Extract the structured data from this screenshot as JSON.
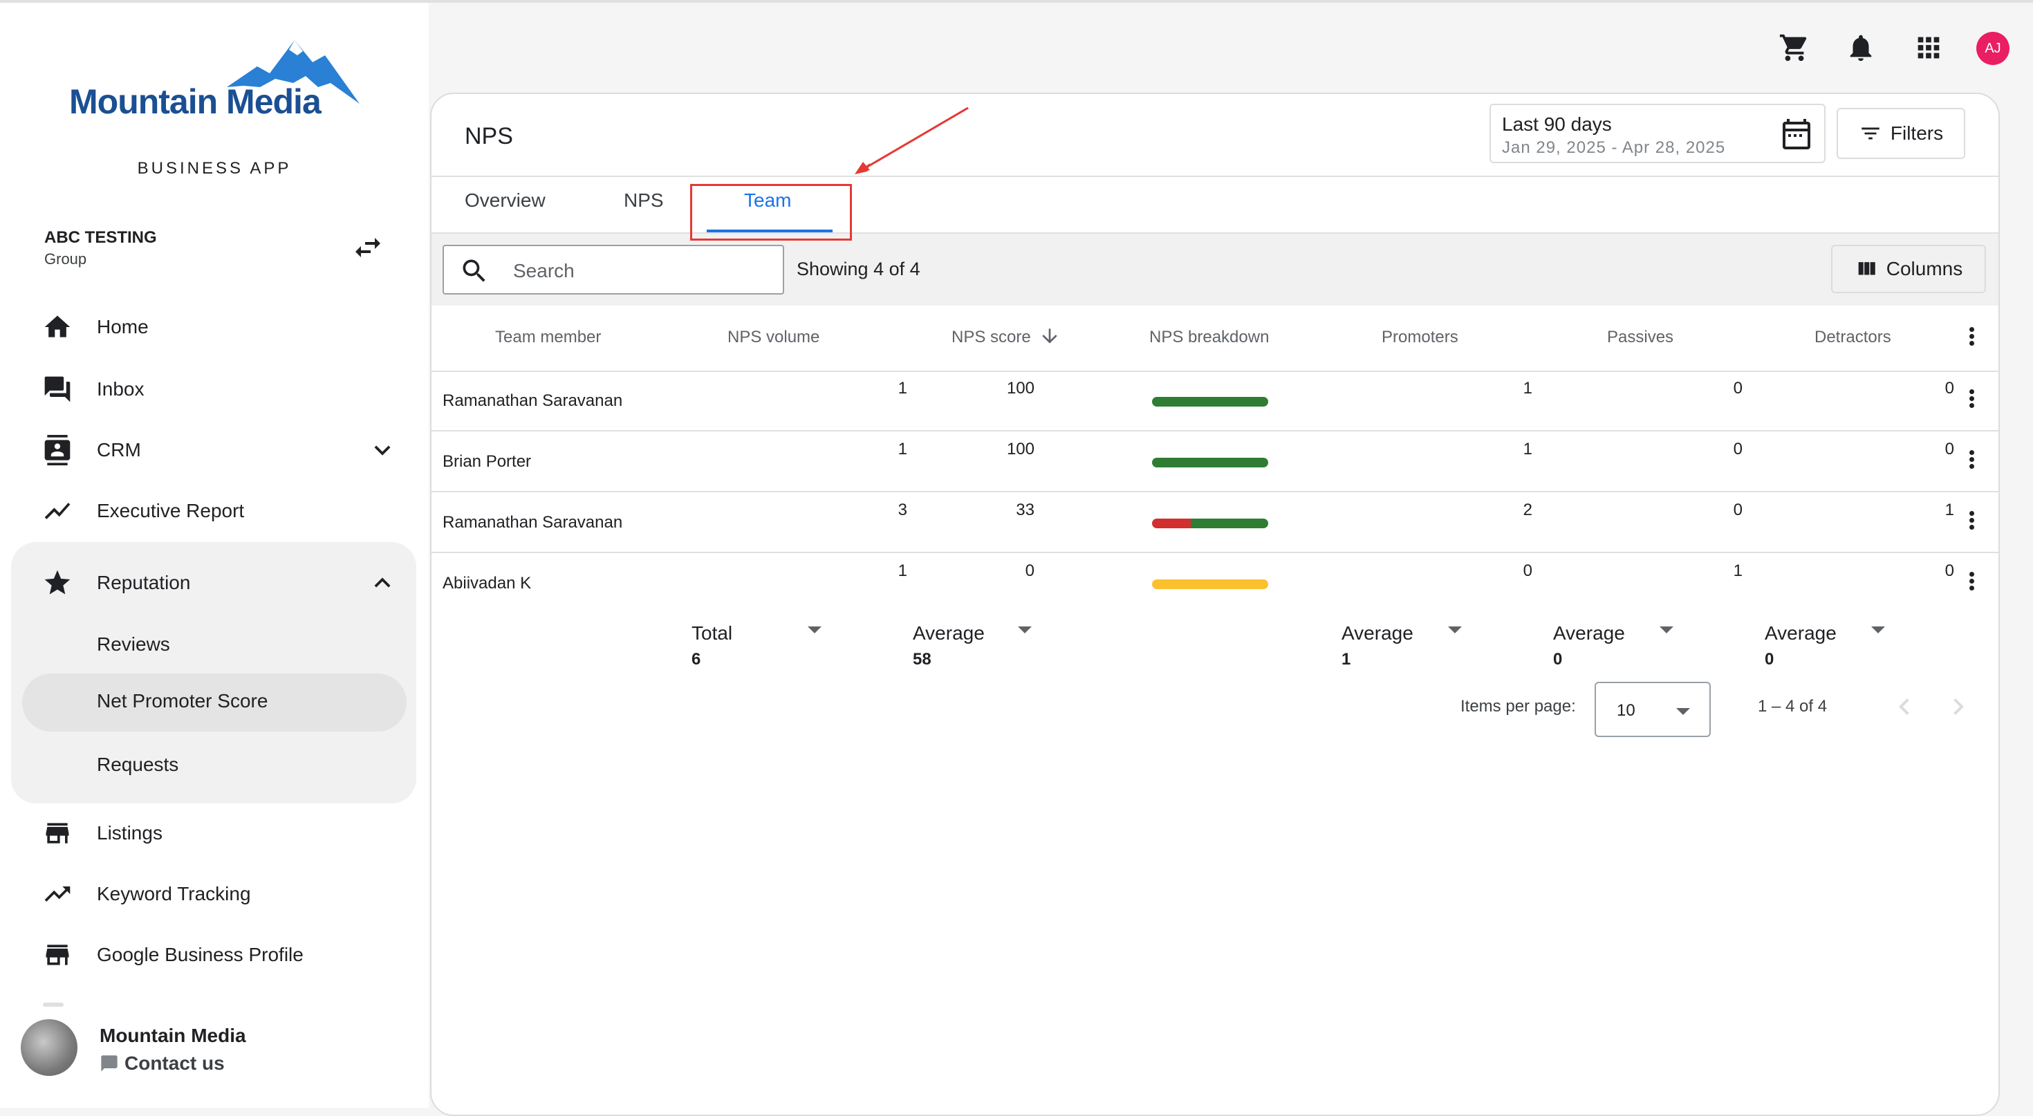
{
  "brand": {
    "name": "Mountain Media",
    "subtitle": "BUSINESS APP"
  },
  "account": {
    "name": "ABC TESTING",
    "type": "Group"
  },
  "nav": {
    "home": "Home",
    "inbox": "Inbox",
    "crm": "CRM",
    "executive_report": "Executive Report",
    "reputation": "Reputation",
    "reviews": "Reviews",
    "nps": "Net Promoter Score",
    "requests": "Requests",
    "listings": "Listings",
    "keyword_tracking": "Keyword Tracking",
    "gbp": "Google Business Profile"
  },
  "footer": {
    "name": "Mountain Media",
    "contact": "Contact us"
  },
  "header": {
    "avatar_initials": "AJ"
  },
  "page": {
    "title": "NPS",
    "date_range": {
      "label": "Last 90 days",
      "dates": "Jan 29, 2025 - Apr 28, 2025"
    },
    "filters_label": "Filters",
    "tabs": [
      "Overview",
      "NPS",
      "Team"
    ],
    "active_tab": "Team"
  },
  "toolbar": {
    "search_placeholder": "Search",
    "showing": "Showing 4 of 4",
    "columns_label": "Columns"
  },
  "table": {
    "headers": {
      "member": "Team member",
      "volume": "NPS volume",
      "score": "NPS score",
      "breakdown": "NPS breakdown",
      "promoters": "Promoters",
      "passives": "Passives",
      "detractors": "Detractors"
    },
    "rows": [
      {
        "member": "Ramanathan Saravanan",
        "volume": "1",
        "score": "100",
        "promoters": "1",
        "passives": "0",
        "detractors": "0"
      },
      {
        "member": "Brian Porter",
        "volume": "1",
        "score": "100",
        "promoters": "1",
        "passives": "0",
        "detractors": "0"
      },
      {
        "member": "Ramanathan Saravanan",
        "volume": "3",
        "score": "33",
        "promoters": "2",
        "passives": "0",
        "detractors": "1"
      },
      {
        "member": "Abiivadan K",
        "volume": "1",
        "score": "0",
        "promoters": "0",
        "passives": "1",
        "detractors": "0"
      }
    ],
    "breakdown_colors": {
      "promoter": "#2e7d32",
      "passive": "#fbc02d",
      "detractor": "#d32f2f"
    },
    "aggregates": {
      "volume": {
        "label": "Total",
        "value": "6"
      },
      "score": {
        "label": "Average",
        "value": "58"
      },
      "promoters": {
        "label": "Average",
        "value": "1"
      },
      "passives": {
        "label": "Average",
        "value": "0"
      },
      "detractors": {
        "label": "Average",
        "value": "0"
      }
    }
  },
  "pagination": {
    "items_per_page_label": "Items per page:",
    "items_per_page": "10",
    "range": "1 – 4 of 4"
  }
}
